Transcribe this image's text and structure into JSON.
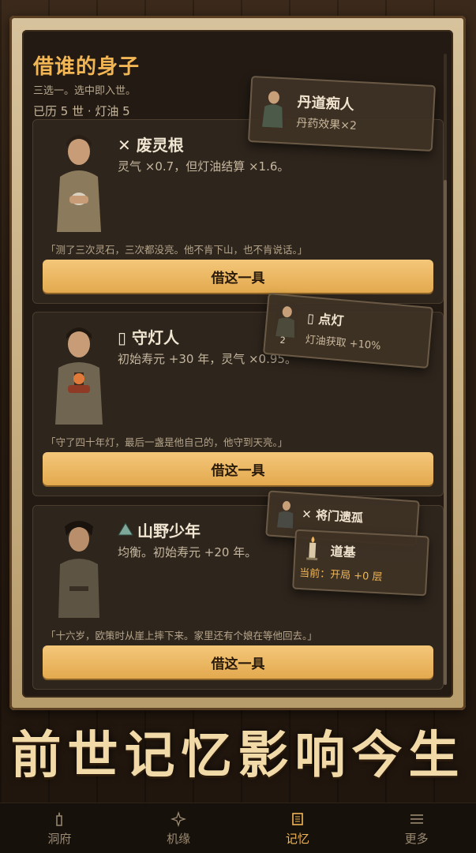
{
  "header": {
    "title": "借谁的身子",
    "subtitle": "三选一。选中即入世。",
    "meta": "已历 5 世 · 灯油 5"
  },
  "cards": [
    {
      "icon": "cross-icon",
      "name": "✕ 废灵根",
      "desc": "灵气 ×0.7，但灯油结算 ×1.6。",
      "quote": "「测了三次灵石，三次都没亮。他不肯下山，也不肯说话。」",
      "button": "借这一具"
    },
    {
      "icon": "lantern-icon",
      "name": "▯ 守灯人",
      "desc": "初始寿元 +30 年，灵气 ×0.95。",
      "quote": "「守了四十年灯，最后一盏是他自己的，他守到天亮。」",
      "button": "借这一具"
    },
    {
      "icon": "mountain-icon",
      "name": "山野少年",
      "desc": "均衡。初始寿元 +20 年。",
      "quote": "「十六岁，欧策时从崖上摔下来。家里还有个娘在等他回去。」",
      "button": "借这一具"
    }
  ],
  "tooltips": {
    "t1": {
      "title": "丹道痴人",
      "desc": "丹药效果×2"
    },
    "t2": {
      "title": "▯ 点灯",
      "desc": "灯油获取 +10%",
      "badge": "2"
    },
    "t3": {
      "title": "✕ 将门遗孤"
    },
    "t4": {
      "title": "道基",
      "desc": "当前：开局 +0 层"
    }
  },
  "slogan": "前世记忆影响今生",
  "nav": [
    {
      "label": "洞府",
      "icon": "candle-icon"
    },
    {
      "label": "机缘",
      "icon": "sparkle-icon"
    },
    {
      "label": "记忆",
      "icon": "scroll-icon",
      "active": true
    },
    {
      "label": "更多",
      "icon": "menu-icon"
    }
  ],
  "colors": {
    "accent": "#f2b655",
    "button": "#e3a94e",
    "panel": "#221a13"
  }
}
